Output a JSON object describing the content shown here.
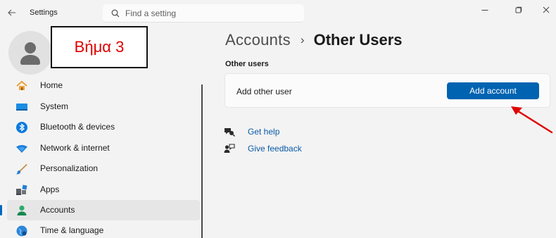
{
  "titlebar": {
    "app_title": "Settings",
    "search_placeholder": "Find a setting",
    "back_icon": "back-arrow-icon",
    "window_controls": [
      "minimize-icon",
      "maximize-icon",
      "close-icon"
    ]
  },
  "annotation": {
    "step_label": "Βήμα 3",
    "step_color": "#e00000",
    "arrow_color": "#e00000"
  },
  "sidebar": {
    "items": [
      {
        "label": "Home",
        "icon": "home-icon",
        "selected": false
      },
      {
        "label": "System",
        "icon": "system-icon",
        "selected": false
      },
      {
        "label": "Bluetooth & devices",
        "icon": "bluetooth-icon",
        "selected": false
      },
      {
        "label": "Network & internet",
        "icon": "network-icon",
        "selected": false
      },
      {
        "label": "Personalization",
        "icon": "personalization-icon",
        "selected": false
      },
      {
        "label": "Apps",
        "icon": "apps-icon",
        "selected": false
      },
      {
        "label": "Accounts",
        "icon": "accounts-icon",
        "selected": true
      },
      {
        "label": "Time & language",
        "icon": "time-language-icon",
        "selected": false
      }
    ]
  },
  "main": {
    "breadcrumb_parent": "Accounts",
    "breadcrumb_separator": "›",
    "breadcrumb_current": "Other Users",
    "section_heading": "Other users",
    "card_label": "Add other user",
    "add_account_label": "Add account",
    "links": [
      {
        "label": "Get help",
        "icon": "help-icon"
      },
      {
        "label": "Give feedback",
        "icon": "feedback-icon"
      }
    ]
  },
  "colors": {
    "accent": "#0063b1",
    "link": "#0a5aa6",
    "selected_bg": "#e6e6e6",
    "window_bg": "#f3f3f3"
  }
}
